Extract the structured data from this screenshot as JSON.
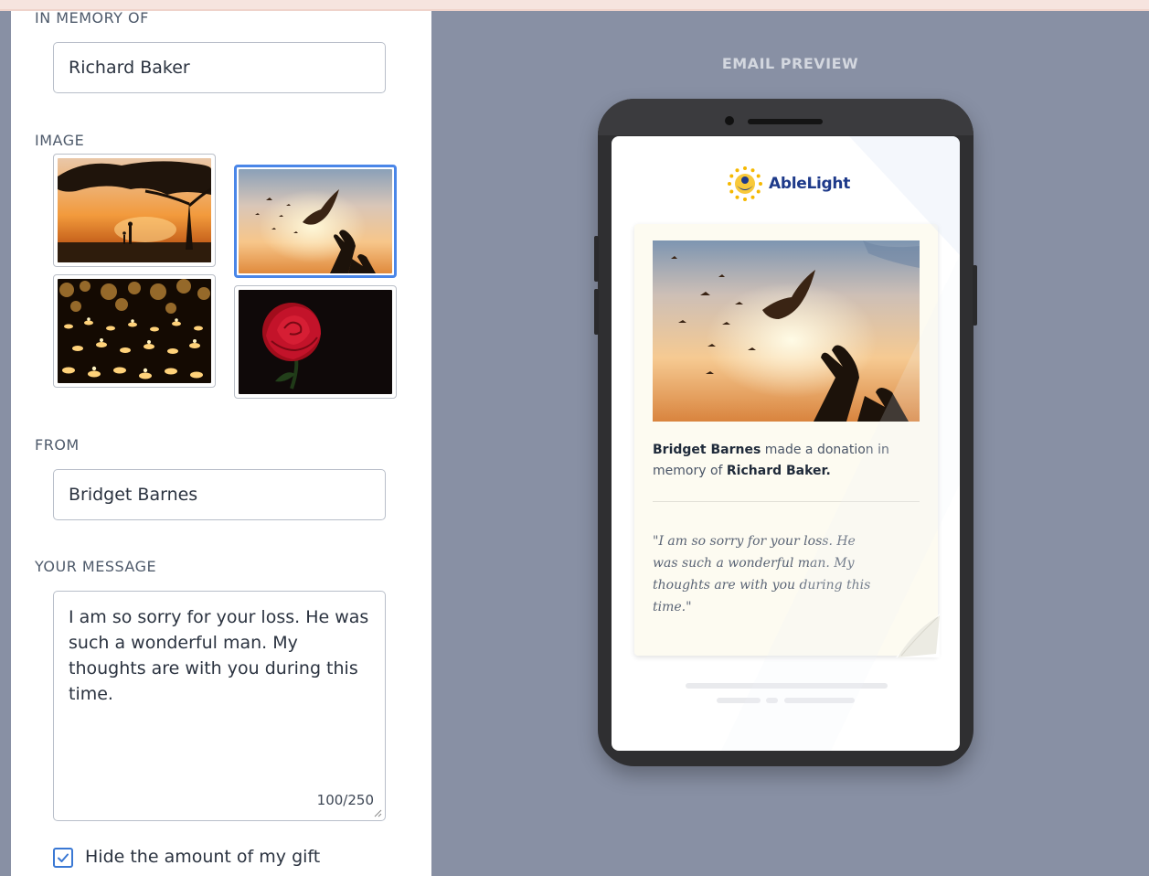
{
  "form": {
    "in_memory_of": {
      "label": "IN MEMORY OF",
      "value": "Richard Baker"
    },
    "image": {
      "label": "IMAGE",
      "options": [
        {
          "name": "sunset-tree-silhouette",
          "selected": false
        },
        {
          "name": "hands-releasing-dove",
          "selected": true
        },
        {
          "name": "candlelight-vigil",
          "selected": false
        },
        {
          "name": "red-rose",
          "selected": false
        }
      ]
    },
    "from": {
      "label": "FROM",
      "value": "Bridget Barnes"
    },
    "message": {
      "label": "YOUR MESSAGE",
      "value": "I am so sorry for your loss. He was such a wonderful man. My thoughts are with you during this time.",
      "counter": "100/250"
    },
    "hide_amount": {
      "label": "Hide the amount of my gift",
      "checked": true
    }
  },
  "preview": {
    "title": "EMAIL PREVIEW",
    "brand": "AbleLight",
    "donor_name": "Bridget Barnes",
    "donation_phrase": "made a donation in memory of",
    "honoree_name": "Richard Baker",
    "period": ".",
    "quote": "\"I am so sorry for your loss. He was such a wonderful man. My thoughts are with you during this time.\""
  },
  "colors": {
    "background": "#8890a4",
    "accent": "#4a86e8",
    "brand": "#1e3a8a",
    "logo_sun": "#f5b800"
  },
  "icons": [
    "checkbox-check-icon",
    "ablelight-logo-icon",
    "resize-grip-icon"
  ]
}
